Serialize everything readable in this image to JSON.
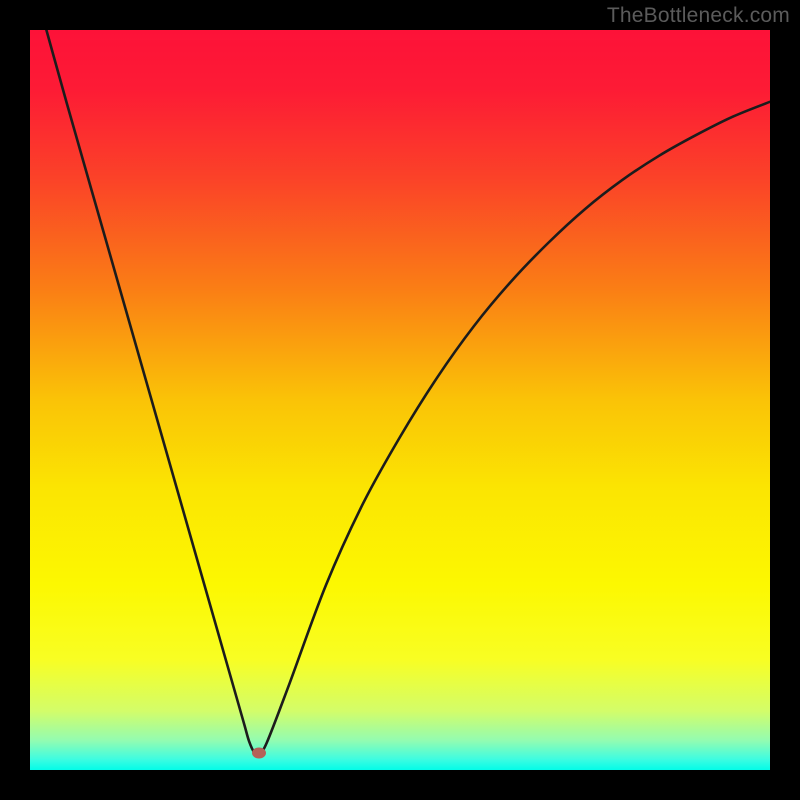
{
  "watermark": "TheBottleneck.com",
  "colors": {
    "dot": "#b46158",
    "curve": "#1c1c1c",
    "frame": "#000000"
  },
  "gradient_stops": [
    {
      "offset": 0,
      "color": "#fd1238"
    },
    {
      "offset": 0.08,
      "color": "#fd1b35"
    },
    {
      "offset": 0.2,
      "color": "#fb4228"
    },
    {
      "offset": 0.35,
      "color": "#fa7e15"
    },
    {
      "offset": 0.5,
      "color": "#fac307"
    },
    {
      "offset": 0.62,
      "color": "#fbe502"
    },
    {
      "offset": 0.75,
      "color": "#fcf801"
    },
    {
      "offset": 0.85,
      "color": "#f8fe23"
    },
    {
      "offset": 0.92,
      "color": "#d3fd69"
    },
    {
      "offset": 0.96,
      "color": "#93fcb1"
    },
    {
      "offset": 0.985,
      "color": "#40fce0"
    },
    {
      "offset": 1.0,
      "color": "#03fce8"
    }
  ],
  "chart_data": {
    "type": "line",
    "title": "",
    "xlabel": "",
    "ylabel": "",
    "xlim": [
      0,
      100
    ],
    "ylim": [
      0,
      100
    ],
    "grid": false,
    "legend": false,
    "dot": {
      "x": 31,
      "y": 2.3
    },
    "series": [
      {
        "name": "bottleneck-curve",
        "x": [
          0,
          5,
          10,
          15,
          20,
          25,
          28,
          29,
          29.6,
          30.3,
          31,
          32,
          35,
          40,
          45,
          50,
          55,
          60,
          65,
          70,
          75,
          80,
          85,
          90,
          95,
          100
        ],
        "y": [
          108,
          90,
          72.5,
          55,
          37.5,
          20,
          9.5,
          6,
          3.9,
          2.4,
          2.3,
          3.7,
          11.5,
          25,
          36,
          45,
          53,
          60,
          66,
          71.2,
          75.8,
          79.7,
          83,
          85.8,
          88.3,
          90.3
        ]
      }
    ]
  }
}
